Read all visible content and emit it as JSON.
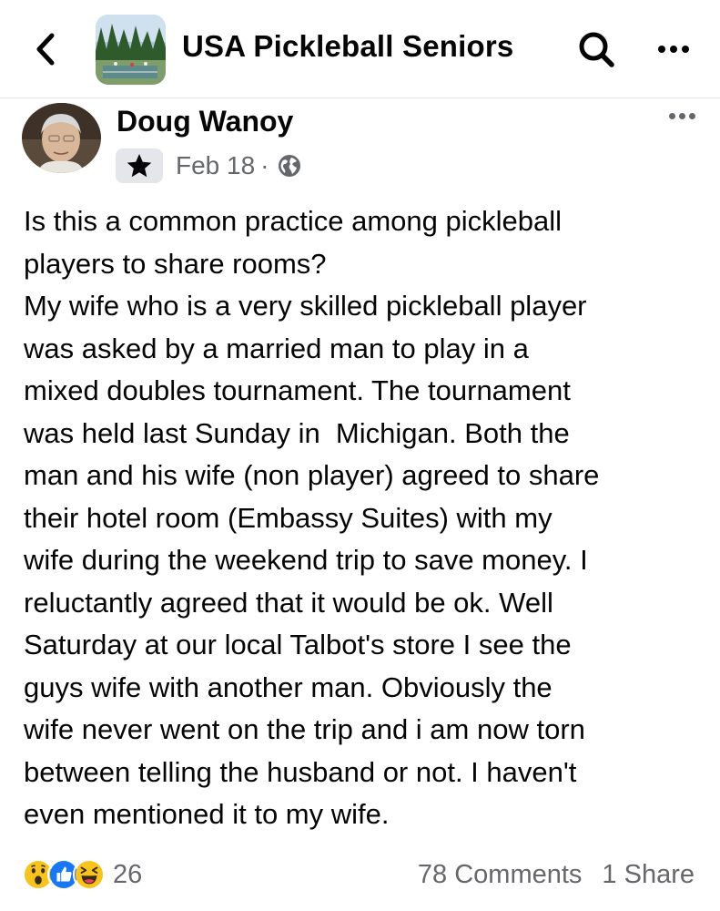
{
  "header": {
    "group_name": "USA Pickleball Seniors",
    "back_icon": "chevron-left-icon",
    "search_icon": "search-icon",
    "more_icon": "more-horizontal-icon"
  },
  "post": {
    "author": "Doug Wanoy",
    "badge_icon": "star-icon",
    "date": "Feb 18",
    "separator": "·",
    "privacy_icon": "globe-icon",
    "text": "Is this a common practice among pickleball\nplayers to share rooms?\nMy wife who is a very skilled pickleball player\nwas asked by a married man to play in a\nmixed doubles tournament. The tournament\nwas held last Sunday in  Michigan. Both the\nman and his wife (non player) agreed to share\ntheir hotel room (Embassy Suites) with my\nwife during the weekend trip to save money. I\nreluctantly agreed that it would be ok. Well\nSaturday at our local Talbot's store I see the\nguys wife with another man. Obviously the\nwife never went on the trip and i am now torn\nbetween telling the husband or not. I haven't\neven mentioned it to my wife."
  },
  "footer": {
    "reaction_icons": [
      "wow-reaction-icon",
      "like-reaction-icon",
      "haha-reaction-icon"
    ],
    "reaction_count": "26",
    "comments": "78 Comments",
    "shares": "1 Share"
  },
  "colors": {
    "text": "#050505",
    "secondary": "#65676b",
    "like_blue": "#1877f2",
    "emoji_yellow": "#f7c41f"
  }
}
